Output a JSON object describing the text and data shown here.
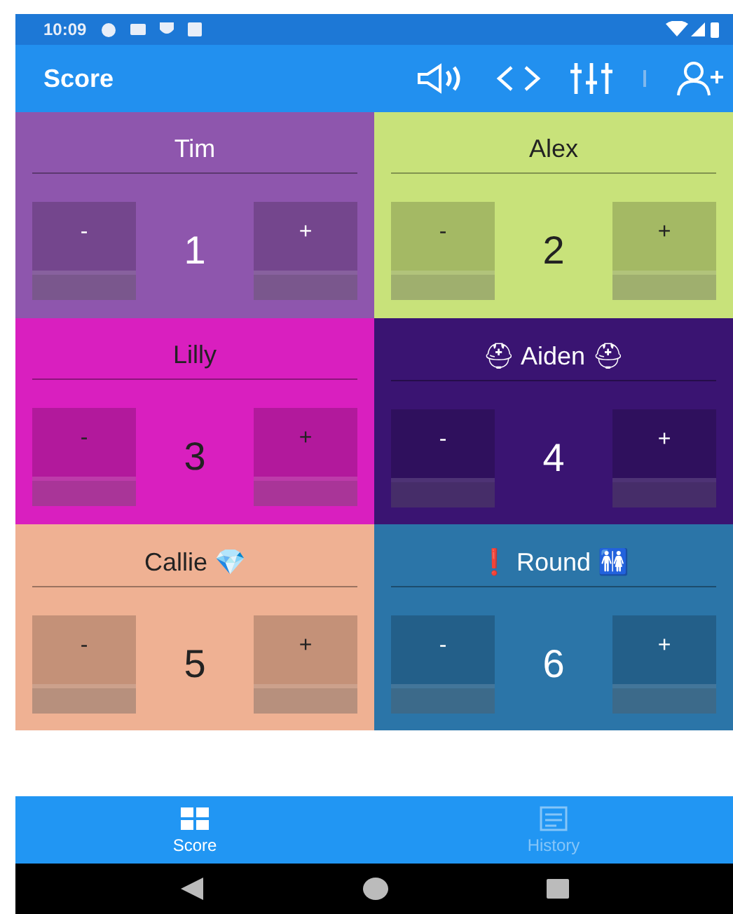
{
  "status_bar": {
    "time": "10:09"
  },
  "app_bar": {
    "title": "Score"
  },
  "players": [
    {
      "name": "Tim",
      "score": "1",
      "minus": "-",
      "plus": "+",
      "color": "#8e56ad"
    },
    {
      "name": "Alex",
      "score": "2",
      "minus": "-",
      "plus": "+",
      "color": "#c8e27a"
    },
    {
      "name": "Lilly",
      "score": "3",
      "minus": "-",
      "plus": "+",
      "color": "#d91fbf"
    },
    {
      "name": "⛑ Aiden ⛑",
      "score": "4",
      "minus": "-",
      "plus": "+",
      "color": "#3a1472"
    },
    {
      "name": "Callie 💎",
      "score": "5",
      "minus": "-",
      "plus": "+",
      "color": "#efb193"
    },
    {
      "name": "❗ Round 🚻",
      "score": "6",
      "minus": "-",
      "plus": "+",
      "color": "#2b75a8"
    }
  ],
  "bottom_nav": [
    {
      "label": "Score",
      "selected": true
    },
    {
      "label": "History",
      "selected": false
    }
  ]
}
